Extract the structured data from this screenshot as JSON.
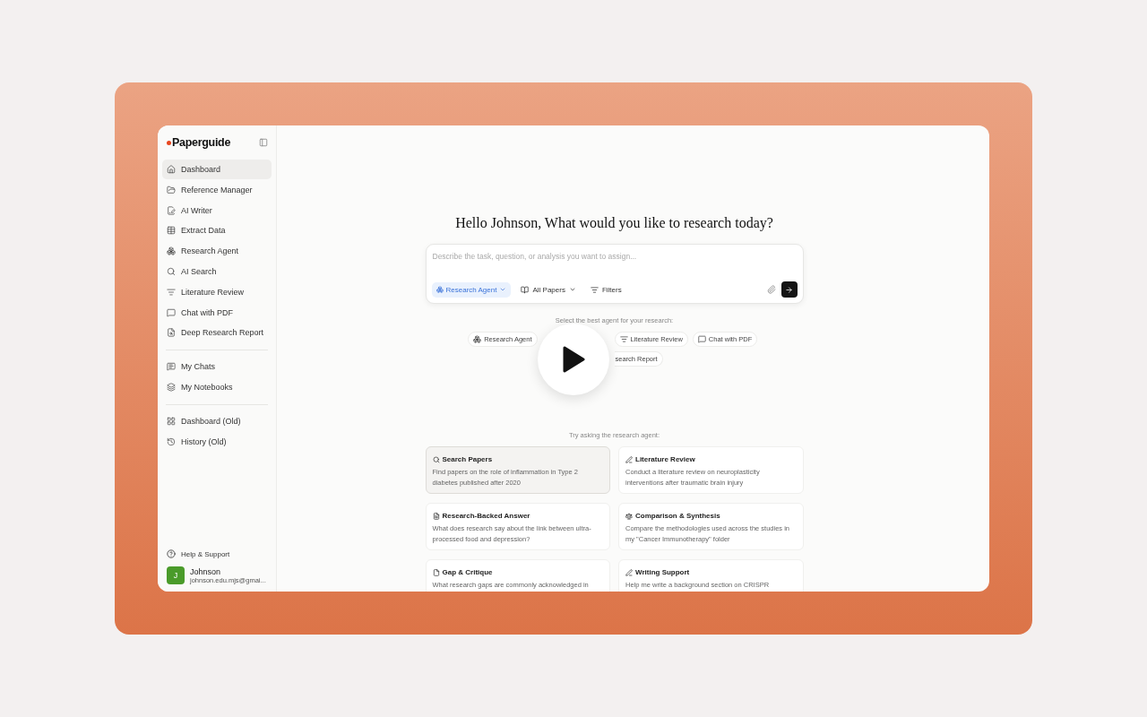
{
  "sidebar": {
    "logo": "Paperguide",
    "groups": [
      [
        {
          "label": "Dashboard",
          "selected": true
        },
        {
          "label": "Reference Manager",
          "selected": false
        },
        {
          "label": "AI Writer",
          "selected": false
        },
        {
          "label": "Extract Data",
          "selected": false
        },
        {
          "label": "Research Agent",
          "selected": false
        },
        {
          "label": "AI Search",
          "selected": false
        },
        {
          "label": "Literature Review",
          "selected": false
        },
        {
          "label": "Chat with PDF",
          "selected": false
        },
        {
          "label": "Deep Research Report",
          "selected": false
        }
      ],
      [
        {
          "label": "My Chats",
          "selected": false
        },
        {
          "label": "My Notebooks",
          "selected": false
        }
      ],
      [
        {
          "label": "Dashboard (Old)",
          "selected": false
        },
        {
          "label": "History (Old)",
          "selected": false
        }
      ]
    ],
    "help": "Help & Support",
    "user": {
      "initial": "J",
      "name": "Johnson",
      "email": "johnson.edu.mjs@gmai..."
    }
  },
  "main": {
    "heading": "Hello Johnson, What would you like to research today?",
    "prompt": {
      "placeholder": "Describe the task, question, or analysis you want to assign...",
      "agent": "Research Agent",
      "source": "All Papers",
      "filters": "Filters"
    },
    "agents_label": "Select the best agent for your research:",
    "agents": [
      "Research Agent",
      "Literature Review",
      "Chat with PDF",
      "search Report"
    ],
    "examples_label": "Try asking the research agent:",
    "examples": [
      {
        "title": "Search Papers",
        "text": "Find papers on the role of inflammation in Type 2 diabetes published after 2020",
        "selected": true
      },
      {
        "title": "Literature Review",
        "text": "Conduct a literature review on neuroplasticity interventions after traumatic brain injury",
        "selected": false
      },
      {
        "title": "Research-Backed Answer",
        "text": "What does research say about the link between ultra-processed food and depression?",
        "selected": false
      },
      {
        "title": "Comparison & Synthesis",
        "text": "Compare the methodologies used across the studies in my \"Cancer Immunotherapy\" folder",
        "selected": false
      },
      {
        "title": "Gap & Critique",
        "text": "What research gaps are commonly acknowledged in",
        "selected": false
      },
      {
        "title": "Writing Support",
        "text": "Help me write a background section on CRISPR",
        "selected": false
      }
    ]
  }
}
